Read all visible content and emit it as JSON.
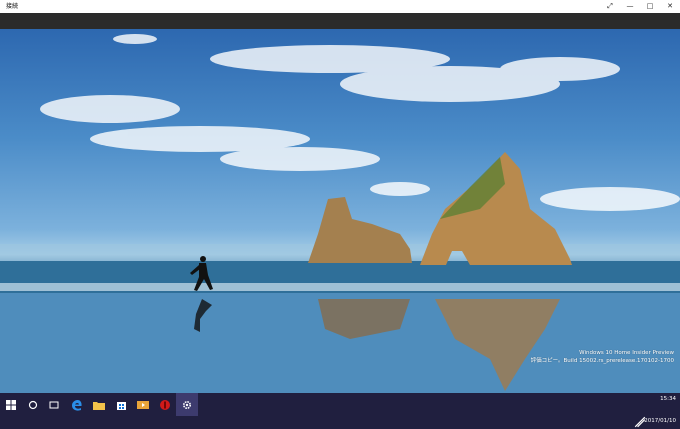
{
  "window": {
    "title": "接続",
    "controls": {
      "fullscreen": "⤢",
      "minimize": "—",
      "maximize": "□",
      "close": "✕"
    }
  },
  "watermark": {
    "line1": "Windows 10 Home Insider Preview",
    "line2": "評価コピー。Build 15002.rs_prerelease.170102-1700"
  },
  "taskbar": {
    "items": [
      {
        "name": "start-button",
        "icon": "windows-logo-icon"
      },
      {
        "name": "cortana-button",
        "icon": "circle-icon"
      },
      {
        "name": "task-view-button",
        "icon": "task-view-icon"
      },
      {
        "name": "edge-button",
        "icon": "edge-icon"
      },
      {
        "name": "file-explorer-button",
        "icon": "folder-icon"
      },
      {
        "name": "store-button",
        "icon": "store-icon"
      },
      {
        "name": "media-button",
        "icon": "media-icon"
      },
      {
        "name": "red-app-button",
        "icon": "red-circle-icon"
      },
      {
        "name": "settings-button",
        "icon": "gear-icon",
        "active": true
      }
    ],
    "clock": {
      "time": "15:34",
      "date": "2017/01/10"
    }
  },
  "colors": {
    "taskbar": "#201f3f",
    "accent": "#3d3b6e",
    "titlebar": "#ffffff"
  }
}
